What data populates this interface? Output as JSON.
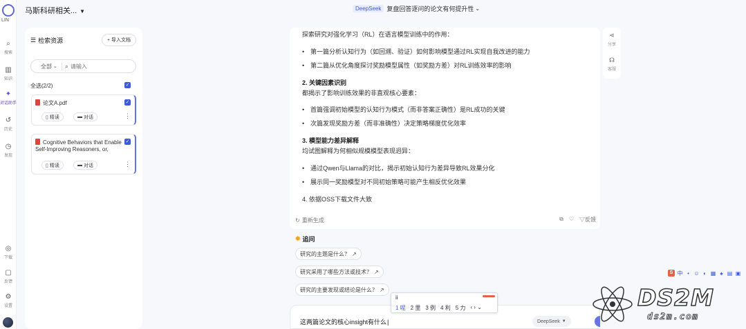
{
  "rail": {
    "logo_label": "LIN",
    "items": [
      {
        "label": "搜索",
        "icon": "search-icon"
      },
      {
        "label": "知识",
        "icon": "book-icon"
      },
      {
        "label": "对话助手",
        "icon": "assistant-icon"
      },
      {
        "label": "历史",
        "icon": "history-icon"
      },
      {
        "label": "发现",
        "icon": "compass-icon"
      }
    ],
    "bottom_items": [
      {
        "label": "下载",
        "icon": "download-icon"
      },
      {
        "label": "反馈",
        "icon": "feedback-icon"
      },
      {
        "label": "设置",
        "icon": "settings-icon"
      }
    ]
  },
  "topbar": {
    "crumb": "马斯科研相关...",
    "model_badge": "DeepSeek",
    "title": "复盘回答逐问的论文有何提升性"
  },
  "kb": {
    "title": "检索资源",
    "upload_label": "导入文档",
    "filter_value": "全部",
    "search_placeholder": "请输入",
    "select_all": "全选(2/2)",
    "docs": [
      {
        "title": "论文A.pdf",
        "btn1": "精读",
        "btn2": "对话"
      },
      {
        "title": "Cognitive Behaviors that Enable Self-Improving Reasoners, or,",
        "btn1": "精读",
        "btn2": "对话"
      }
    ]
  },
  "answer": {
    "intro": "探索研究对强化学习（RL）在语言模型训练中的作用：",
    "bullets1": [
      "第一篇分析认知行为（如回溯、验证）如何影响模型通过RL实现自我改进的能力",
      "第二篇从优化角度探讨奖励模型属性（如奖励方差）对RL训练效率的影响"
    ],
    "h2": "2. 关键因素识别",
    "h2_text": "都揭示了影响训练效果的非直观核心要素：",
    "bullets2": [
      "首篇强调初始模型的认知行为模式（而非答案正确性）是RL成功的关键",
      "次篇发现奖励方差（而非准确性）决定策略梯度优化效率"
    ],
    "h3": "3. 模型能力差异解释",
    "h3_text": "均试图解释为何相似规模模型表现迥异：",
    "bullets3": [
      "通过Qwen与Llama的对比，揭示初始认知行为差异导致RL效果分化",
      "展示同一奖励模型对不同初始策略可能产生相反优化效果"
    ],
    "h4": "4. 依据OSS下载文件大致",
    "regenerate": "重新生成",
    "copy": "复制",
    "like": "点赞",
    "dislike": "反馈"
  },
  "followups": {
    "title": "追问",
    "items": [
      "研究的主题是什么？",
      "研究采用了哪些方法或技术？",
      "研究的主要发现或结论是什么？"
    ]
  },
  "input": {
    "value": "这两篇论文的核心insight有什么",
    "model": "DeepSeek"
  },
  "ime": {
    "composition": "ii",
    "candidates": [
      "1 呢",
      "2 里",
      "3 例",
      "4 利",
      "5 力"
    ]
  },
  "side_tools": [
    {
      "label": "分享",
      "icon": "share-icon"
    },
    {
      "label": "客服",
      "icon": "headset-icon"
    }
  ],
  "tray": {
    "items": [
      "S",
      "中",
      "•",
      "☺",
      "◐",
      "▦",
      "♠",
      "▤",
      "▣"
    ]
  },
  "watermark": {
    "big": "DS2M",
    "small": "ds2m.com"
  }
}
